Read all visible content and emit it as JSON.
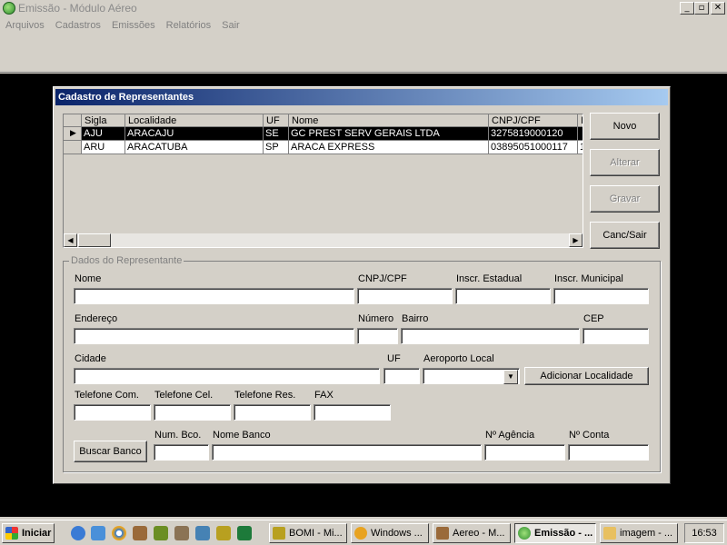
{
  "window": {
    "title": "Emissão - Módulo Aéreo"
  },
  "menu": [
    "Arquivos",
    "Cadastros",
    "Emissões",
    "Relatórios",
    "Sair"
  ],
  "dialog": {
    "title": "Cadastro de Representantes",
    "grid": {
      "columns": [
        "Sigla",
        "Localidade",
        "UF",
        "Nome",
        "CNPJ/CPF",
        "I"
      ],
      "rows": [
        [
          "AJU",
          "ARACAJU",
          "SE",
          "GC PREST SERV GERAIS LTDA",
          "3275819000120",
          ""
        ],
        [
          "ARU",
          "ARACATUBA",
          "SP",
          "ARACA EXPRESS",
          "03895051000117",
          "1"
        ]
      ]
    },
    "buttons": {
      "novo": "Novo",
      "alterar": "Alterar",
      "gravar": "Gravar",
      "canc_sair": "Canc/Sair"
    },
    "form": {
      "group_title": "Dados do Representante",
      "labels": {
        "nome": "Nome",
        "cnpj": "CNPJ/CPF",
        "inscr_estadual": "Inscr. Estadual",
        "inscr_municipal": "Inscr. Municipal",
        "endereco": "Endereço",
        "numero": "Número",
        "bairro": "Bairro",
        "cep": "CEP",
        "cidade": "Cidade",
        "uf": "UF",
        "aeroporto": "Aeroporto Local",
        "tel_com": "Telefone Com.",
        "tel_cel": "Telefone Cel.",
        "tel_res": "Telefone Res.",
        "fax": "FAX",
        "num_bco": "Num. Bco.",
        "nome_banco": "Nome Banco",
        "agencia": "Nº Agência",
        "conta": "Nº Conta"
      },
      "adicionar_localidade": "Adicionar Localidade",
      "buscar_banco": "Buscar Banco"
    }
  },
  "taskbar": {
    "start": "Iniciar",
    "tasks": [
      "BOMI - Mi...",
      "Windows ...",
      "Aereo - M...",
      "Emissão - ...",
      "imagem - ..."
    ],
    "clock": "16:53"
  }
}
